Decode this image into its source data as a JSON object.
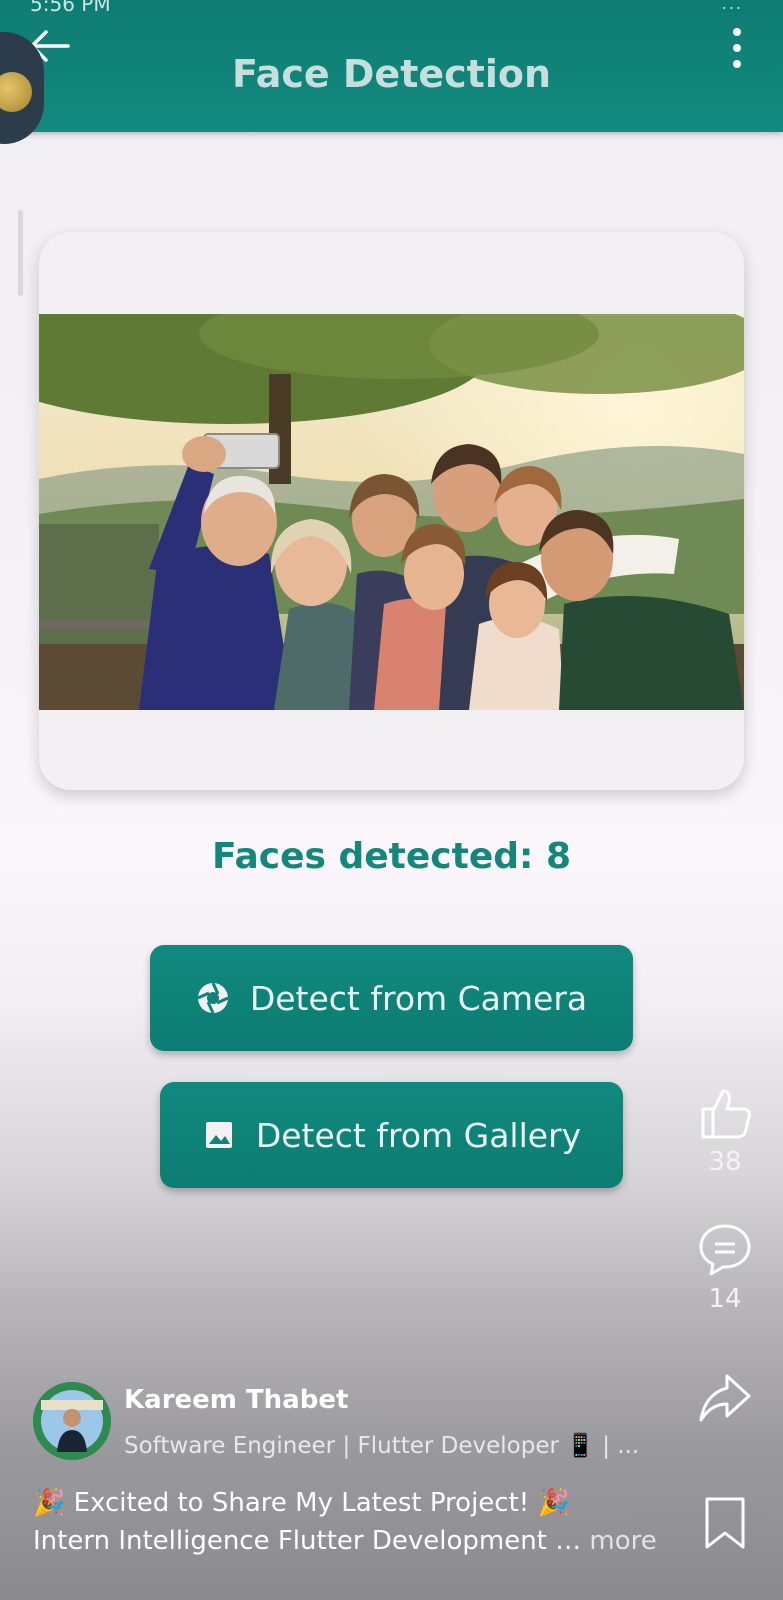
{
  "app": {
    "title": "Face Detection",
    "status_time": "5:56 PM",
    "status_right": "..."
  },
  "result": {
    "faces_label": "Faces detected: 8"
  },
  "buttons": {
    "camera": "Detect from Camera",
    "gallery": "Detect from Gallery"
  },
  "social": {
    "likes": "38",
    "comments": "14"
  },
  "post": {
    "author": "Kareem Thabet",
    "headline": "Software Engineer | Flutter Developer 📱 | ...",
    "line1": "🎉 Excited to Share My Latest Project! 🎉",
    "line2": "Intern Intelligence Flutter Development …",
    "more": "more"
  },
  "colors": {
    "teal": "#128a7f",
    "text_teal": "#13877c"
  },
  "icons": {
    "back": "arrow-left-icon",
    "menu": "more-vert-icon",
    "camera": "camera-aperture-icon",
    "gallery": "image-icon",
    "like": "thumb-up-icon",
    "comment": "comment-icon",
    "share": "share-icon",
    "save": "bookmark-icon"
  }
}
